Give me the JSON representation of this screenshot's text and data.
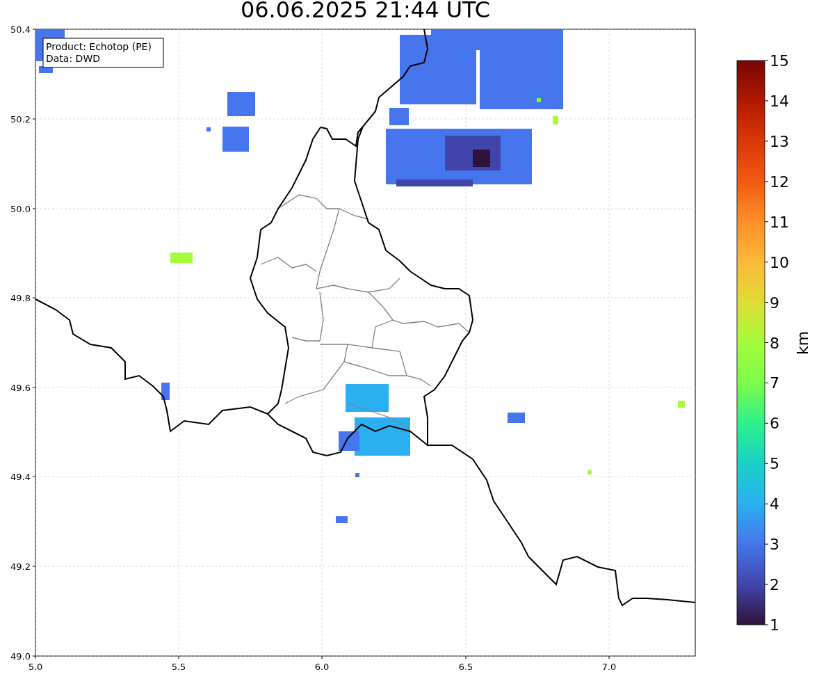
{
  "title": "06.06.2025 21:44 UTC",
  "legend": [
    "Product: Echotop (PE)",
    "Data: DWD"
  ],
  "axes": {
    "xticks": [
      "5.0",
      "5.5",
      "6.0",
      "6.5",
      "7.0"
    ],
    "yticks": [
      "50.4",
      "50.2",
      "50.0",
      "49.8",
      "49.6",
      "49.4",
      "49.2",
      "49.0"
    ]
  },
  "colorbar": {
    "label": "km",
    "ticks": [
      "15",
      "14",
      "13",
      "12",
      "11",
      "10",
      "9",
      "8",
      "7",
      "6",
      "5",
      "4",
      "3",
      "2",
      "1"
    ]
  }
}
